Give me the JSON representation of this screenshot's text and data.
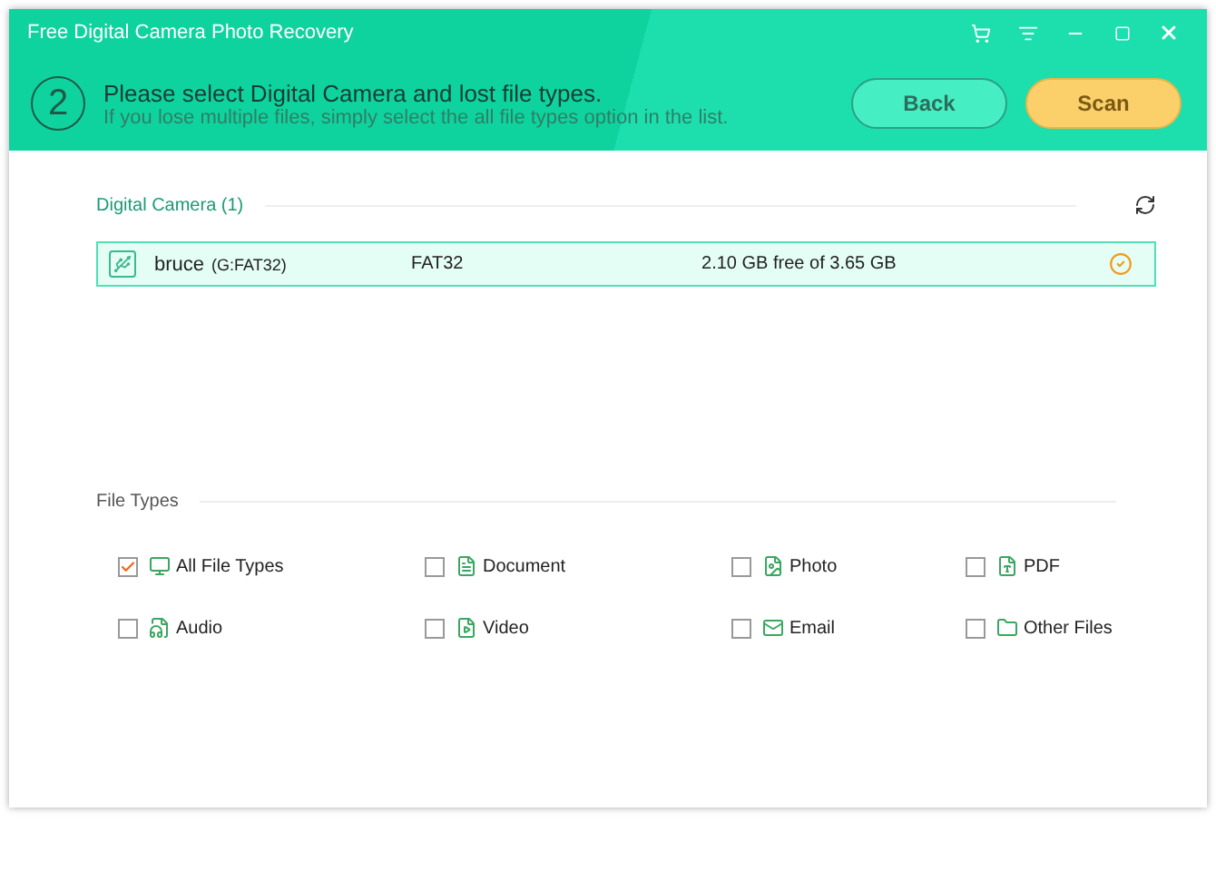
{
  "window": {
    "title": "Free Digital Camera Photo Recovery"
  },
  "step": {
    "number": "2",
    "title": "Please select Digital Camera and lost file types.",
    "subtitle": "If you lose multiple files, simply select the all file types option in the list."
  },
  "buttons": [
    {
      "label": "Back",
      "kind": "secondary"
    },
    {
      "label": "Scan",
      "kind": "primary"
    }
  ],
  "devices_section": {
    "title": "Digital Camera (1)"
  },
  "devices": [
    {
      "name": "bruce",
      "drive": "(G:FAT32)",
      "filesystem": "FAT32",
      "space": "2.10 GB free of 3.65 GB",
      "selected": true
    }
  ],
  "file_types_section": {
    "title": "File Types"
  },
  "file_types": [
    {
      "label": "All File Types",
      "kind": "all",
      "checked": true
    },
    {
      "label": "Document",
      "kind": "document",
      "checked": false
    },
    {
      "label": "Photo",
      "kind": "photo",
      "checked": false
    },
    {
      "label": "PDF",
      "kind": "pdf",
      "checked": false
    },
    {
      "label": "Audio",
      "kind": "audio",
      "checked": false
    },
    {
      "label": "Video",
      "kind": "video",
      "checked": false
    },
    {
      "label": "Email",
      "kind": "email",
      "checked": false
    },
    {
      "label": "Other Files",
      "kind": "other",
      "checked": false
    }
  ]
}
